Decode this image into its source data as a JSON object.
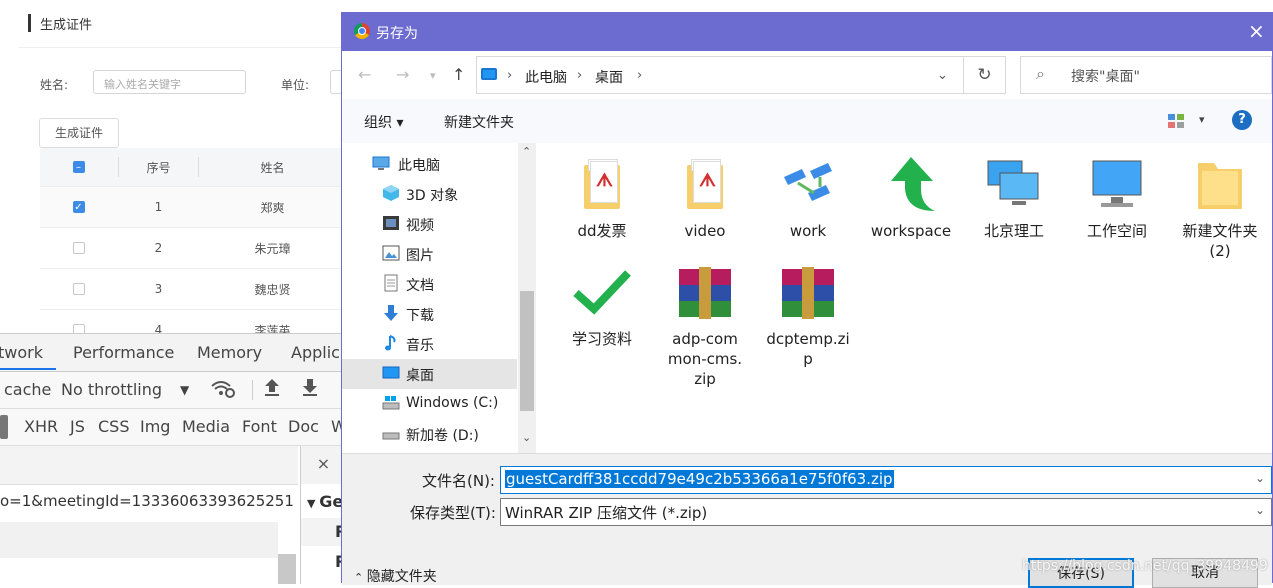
{
  "webpage": {
    "breadcrumb": "生成证件",
    "filters": {
      "name_label": "姓名:",
      "name_placeholder": "输入姓名关键字",
      "unit_label": "单位:"
    },
    "generate_button": "生成证件",
    "table": {
      "headers": [
        "序号",
        "姓名"
      ],
      "rows": [
        {
          "no": "1",
          "name": "郑爽",
          "checked": true
        },
        {
          "no": "2",
          "name": "朱元璋",
          "checked": false
        },
        {
          "no": "3",
          "name": "魏忠贤",
          "checked": false
        },
        {
          "no": "4",
          "name": "李莲英",
          "checked": false
        }
      ]
    }
  },
  "devtools": {
    "tabs": [
      "twork",
      "Performance",
      "Memory",
      "Applica"
    ],
    "toolbar": {
      "cache": "cache",
      "throttling": "No throttling"
    },
    "filters": [
      "XHR",
      "JS",
      "CSS",
      "Img",
      "Media",
      "Font",
      "Doc",
      "W"
    ],
    "request_url": "o=1&meetingId=13336063393625251",
    "close": "×",
    "detail_header": "Ge",
    "detail_rows": [
      "R",
      "R"
    ]
  },
  "dialog": {
    "title": "另存为",
    "close": "×",
    "address": {
      "root": "此电脑",
      "current": "桌面"
    },
    "search_placeholder": "搜索\"桌面\"",
    "toolbar": {
      "organize": "组织 ▾",
      "new_folder": "新建文件夹",
      "help": "?"
    },
    "nav_items": [
      {
        "label": "此电脑",
        "icon": "computer-icon"
      },
      {
        "label": "3D 对象",
        "icon": "cube-icon"
      },
      {
        "label": "视频",
        "icon": "video-icon"
      },
      {
        "label": "图片",
        "icon": "picture-icon"
      },
      {
        "label": "文档",
        "icon": "document-icon"
      },
      {
        "label": "下载",
        "icon": "download-icon"
      },
      {
        "label": "音乐",
        "icon": "music-icon"
      },
      {
        "label": "桌面",
        "icon": "desktop-icon",
        "selected": true
      },
      {
        "label": "Windows (C:)",
        "icon": "drive-icon"
      },
      {
        "label": "新加卷 (D:)",
        "icon": "drive-icon"
      }
    ],
    "files": [
      {
        "label": "dd发票",
        "icon": "pdf-folder-icon"
      },
      {
        "label": "video",
        "icon": "pdf-folder-icon"
      },
      {
        "label": "work",
        "icon": "network-icon"
      },
      {
        "label": "workspace",
        "icon": "green-arrow-icon"
      },
      {
        "label": "北京理工",
        "icon": "computers-icon"
      },
      {
        "label": "工作空间",
        "icon": "computer-icon"
      },
      {
        "label": "新建文件夹 (2)",
        "icon": "folder-icon"
      },
      {
        "label": "学习资料",
        "icon": "checkmark-icon"
      },
      {
        "label": "adp-common-cms.zip",
        "icon": "winrar-icon"
      },
      {
        "label": "dcptemp.zip",
        "icon": "winrar-icon"
      }
    ],
    "filename_label": "文件名(N):",
    "filename": "guestCardff381ccdd79e49c2b53366a1e75f0f63.zip",
    "filetype_label": "保存类型(T):",
    "filetype": "WinRAR ZIP 压缩文件 (*.zip)",
    "hide_folders": "隐藏文件夹",
    "save_button": "保存(S)",
    "cancel_button": "取消",
    "watermark": "https://blog.csdn.net/qq_39948499"
  },
  "colors": {
    "title_bar": "#6b6bd0",
    "accent": "#0078d7",
    "checkbox": "#3c8ce7"
  }
}
